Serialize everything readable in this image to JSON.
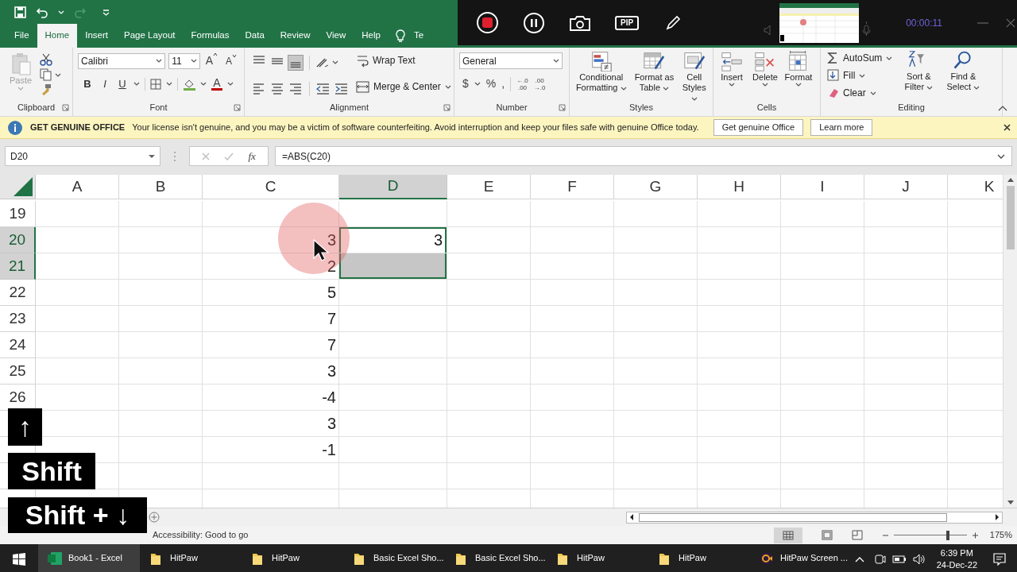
{
  "tabs": [
    {
      "label": "File",
      "selected": false
    },
    {
      "label": "Home",
      "selected": true
    },
    {
      "label": "Insert",
      "selected": false
    },
    {
      "label": "Page Layout",
      "selected": false
    },
    {
      "label": "Formulas",
      "selected": false
    },
    {
      "label": "Data",
      "selected": false
    },
    {
      "label": "Review",
      "selected": false
    },
    {
      "label": "View",
      "selected": false
    },
    {
      "label": "Help",
      "selected": false
    },
    {
      "label": "Te",
      "selected": false
    }
  ],
  "ribbon": {
    "paste": "Paste",
    "font_name": "Calibri",
    "font_size": "11",
    "size_buttons": [
      "A",
      "A"
    ],
    "style_buttons": [
      "B",
      "I",
      "U"
    ],
    "font_color": "A",
    "wrap_text": "Wrap Text",
    "merge_center": "Merge & Center",
    "number_format": "General",
    "number_symbols": [
      "$",
      "%",
      ","
    ],
    "decimal_buttons": [
      {
        "top": "←.0",
        "bottom": ".00"
      },
      {
        "top": ".00",
        "bottom": "→.0"
      }
    ],
    "styles": [
      {
        "label": "Conditional Formatting",
        "kind": "conditional"
      },
      {
        "label": "Format as Table",
        "kind": "table"
      },
      {
        "label": "Cell Styles",
        "kind": "cellstyles"
      }
    ],
    "cells": [
      {
        "label": "Insert",
        "kind": "insert"
      },
      {
        "label": "Delete",
        "kind": "delete"
      },
      {
        "label": "Format",
        "kind": "format"
      }
    ],
    "editing_small": [
      {
        "label": "AutoSum",
        "kind": "sum"
      },
      {
        "label": "Fill",
        "kind": "fill"
      },
      {
        "label": "Clear",
        "kind": "clear"
      }
    ],
    "editing_large": [
      {
        "label": "Sort & Filter",
        "kind": "sort"
      },
      {
        "label": "Find & Select",
        "kind": "find"
      }
    ],
    "groups": [
      "Clipboard",
      "Font",
      "Alignment",
      "Number",
      "Styles",
      "Cells",
      "Editing"
    ]
  },
  "recorder": {
    "pip": "PIP",
    "timer": "00:00:11"
  },
  "notice": {
    "title": "GET GENUINE OFFICE",
    "message": "Your license isn't genuine, and you may be a victim of software counterfeiting. Avoid interruption and keep your files safe with genuine Office today.",
    "buttons": [
      "Get genuine Office",
      "Learn more"
    ]
  },
  "formula_bar": {
    "name_box": "D20",
    "function_label": "fx",
    "formula": "=ABS(C20)"
  },
  "columns": [
    {
      "label": "A",
      "selected": false
    },
    {
      "label": "B",
      "selected": false
    },
    {
      "label": "C",
      "selected": false
    },
    {
      "label": "D",
      "selected": true
    },
    {
      "label": "E",
      "selected": false
    },
    {
      "label": "F",
      "selected": false
    },
    {
      "label": "G",
      "selected": false
    },
    {
      "label": "H",
      "selected": false
    },
    {
      "label": "I",
      "selected": false
    },
    {
      "label": "J",
      "selected": false
    },
    {
      "label": "K",
      "selected": false
    }
  ],
  "rows": [
    {
      "header": "19",
      "selected": false,
      "d_selected": false
    },
    {
      "header": "20",
      "selected": true,
      "c": "3",
      "d": "3",
      "d_selected": true,
      "d_active": true
    },
    {
      "header": "21",
      "selected": true,
      "c": "2",
      "d_selected": true,
      "d_active": false
    },
    {
      "header": "22",
      "selected": false,
      "c": "5",
      "d_selected": false
    },
    {
      "header": "23",
      "selected": false,
      "c": "7",
      "d_selected": false
    },
    {
      "header": "24",
      "selected": false,
      "c": "7",
      "d_selected": false
    },
    {
      "header": "25",
      "selected": false,
      "c": "3",
      "d_selected": false
    },
    {
      "header": "26",
      "selected": false,
      "c": "-4",
      "d_selected": false
    },
    {
      "selected": false,
      "c": "3",
      "d_selected": false
    },
    {
      "selected": false,
      "c": "-1",
      "d_selected": false
    },
    {
      "selected": false,
      "d_selected": false
    },
    {
      "selected": false,
      "d_selected": false
    }
  ],
  "keys": [
    "↑",
    "Shift",
    "Shift + ↓"
  ],
  "status_bar": {
    "accessibility": "Accessibility: Good to go",
    "zoom": "175%",
    "zoom_slider": {
      "level": 0.72
    }
  },
  "taskbar": {
    "items": [
      {
        "label": "Book1 - Excel",
        "kind": "excel",
        "selected": true
      },
      {
        "label": "HitPaw",
        "kind": "folder",
        "selected": false
      },
      {
        "label": "HitPaw",
        "kind": "folder",
        "selected": false
      },
      {
        "label": "Basic Excel Sho...",
        "kind": "folder",
        "selected": false
      },
      {
        "label": "Basic Excel Sho...",
        "kind": "folder",
        "selected": false
      },
      {
        "label": "HitPaw",
        "kind": "folder",
        "selected": false
      },
      {
        "label": "HitPaw",
        "kind": "folder",
        "selected": false
      },
      {
        "label": "HitPaw Screen ...",
        "kind": "recorder",
        "selected": false
      }
    ],
    "time": "6:39 PM",
    "date": "24-Dec-22"
  }
}
